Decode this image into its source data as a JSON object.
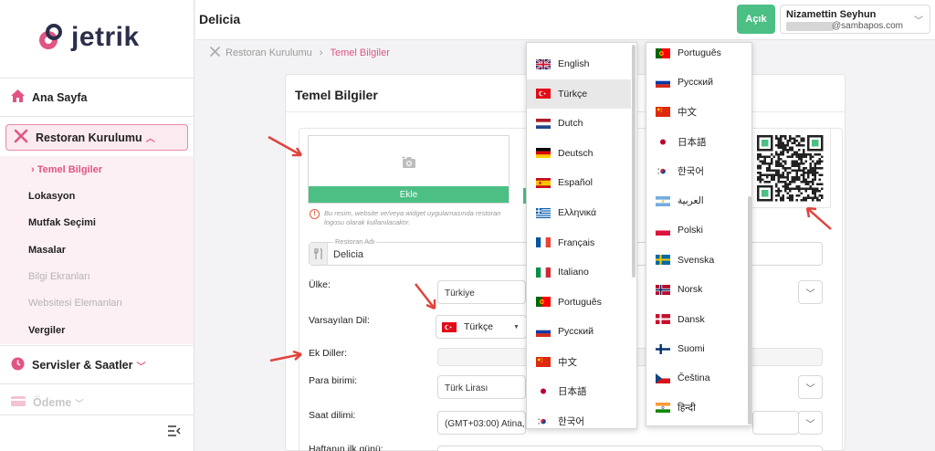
{
  "brand": {
    "name": "jetrik"
  },
  "header": {
    "title": "Delicia",
    "open_button": "Açık",
    "user_name": "Nizamettin Seyhun",
    "user_email": "@sambapos.com"
  },
  "sidebar": {
    "home": "Ana Sayfa",
    "restaurant_setup": "Restoran Kurulumu",
    "sub_items": [
      "Temel Bilgiler",
      "Lokasyon",
      "Mutfak Seçimi",
      "Masalar",
      "Bilgi Ekranları",
      "Websitesi Elemanları",
      "Vergiler"
    ],
    "services": "Servisler & Saatler",
    "payment": "Ödeme"
  },
  "breadcrumb": {
    "parent": "Restoran Kurulumu",
    "current": "Temel Bilgiler"
  },
  "form": {
    "card_title": "Temel Bilgiler",
    "upload_button": "Ekle",
    "upload_note": "Bu resim, website ve/veya widget uygulamasında restoran logosu olarak kullanılacaktır.",
    "restaurant_name_label": "Restoran Adı",
    "restaurant_name_value": "Delicia",
    "country_label": "Ülke:",
    "country_value": "Türkiye",
    "default_language_label": "Varsayılan Dil:",
    "default_language_value": "Türkçe",
    "extra_languages_label": "Ek Diller:",
    "currency_label": "Para birimi:",
    "currency_value": "Türk Lirası",
    "timezone_label": "Saat dilimi:",
    "timezone_value": "(GMT+03:00) Atina,",
    "week_start_label": "Haftanın ilk günü:"
  },
  "dropdown_left": [
    "English",
    "Türkçe",
    "Dutch",
    "Deutsch",
    "Español",
    "Ελληνικά",
    "Français",
    "Italiano",
    "Português",
    "Русский",
    "中文",
    "日本語",
    "한국어"
  ],
  "dropdown_left_selected": "Türkçe",
  "dropdown_right": [
    "Português",
    "Русский",
    "中文",
    "日本語",
    "한국어",
    "العربية",
    "Polski",
    "Svenska",
    "Norsk",
    "Dansk",
    "Suomi",
    "Čeština",
    "हिन्दी"
  ],
  "colors": {
    "accent": "#e05584",
    "green": "#4cbf85",
    "arrow": "#e0443c"
  }
}
